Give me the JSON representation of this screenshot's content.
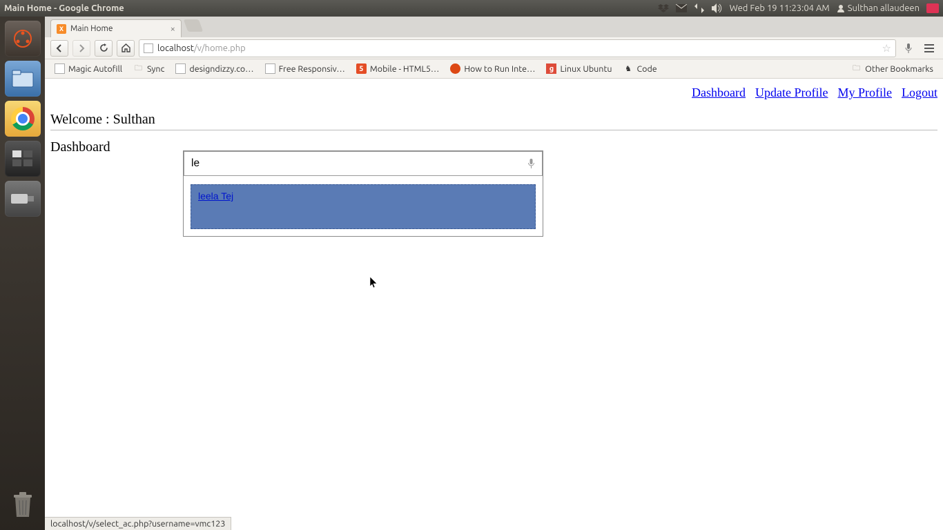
{
  "panel": {
    "window_title": "Main Home - Google Chrome",
    "clock": "Wed Feb 19 11:23:04 AM",
    "user": "Sulthan allaudeen"
  },
  "tab": {
    "title": "Main Home"
  },
  "urlbar": {
    "host": "localhost",
    "path": "/v/home.php"
  },
  "bookmarks": {
    "b0": "Magic Autofill",
    "b1": "Sync",
    "b2": "designdizzy.co…",
    "b3": "Free Responsiv…",
    "b4": "Mobile - HTML5…",
    "b5": "How to Run Inte…",
    "b6": "Linux Ubuntu",
    "b7": "Code",
    "other": "Other Bookmarks"
  },
  "nav": {
    "dashboard": "Dashboard",
    "update_profile": "Update Profile",
    "my_profile": "My Profile",
    "logout": "Logout"
  },
  "page": {
    "welcome": "Welcome : Sulthan",
    "section": "Dashboard"
  },
  "search": {
    "value": "le",
    "result0": "leela Tej"
  },
  "status": "localhost/v/select_ac.php?username=vmc123"
}
